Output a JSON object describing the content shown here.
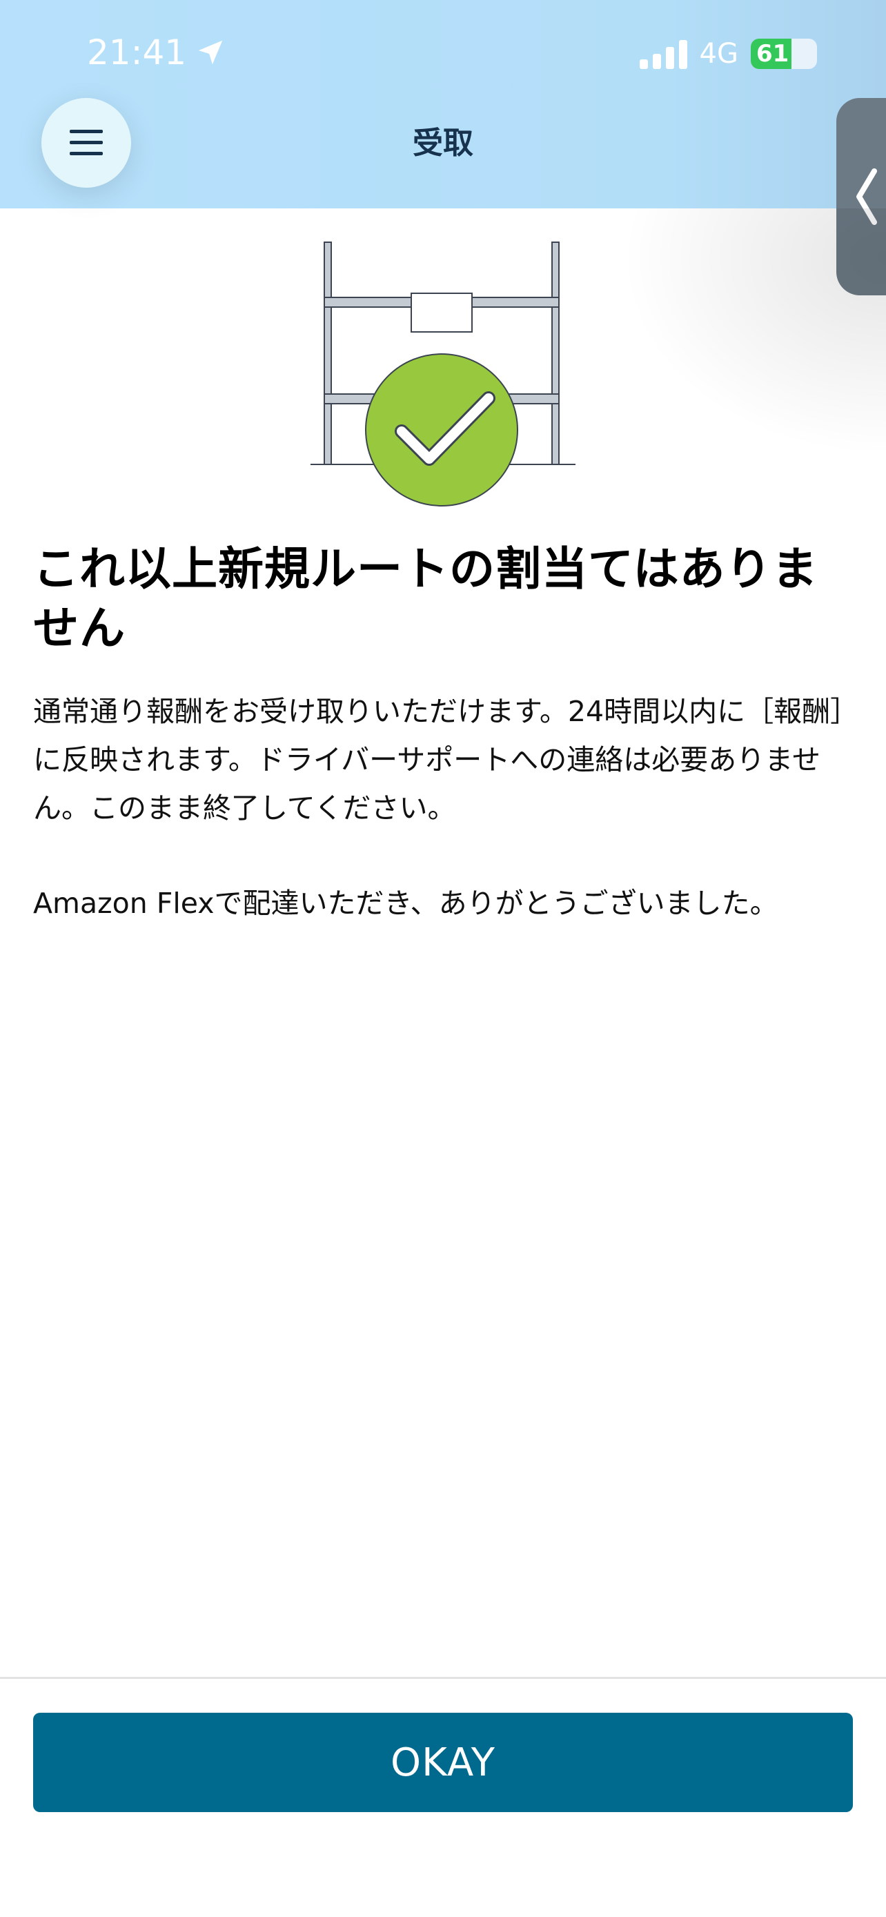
{
  "status_bar": {
    "time": "21:41",
    "network": "4G",
    "battery": "61",
    "battery_level": 0.61,
    "location_icon": "location-arrow-icon",
    "signal_icon": "signal-bars-icon"
  },
  "header": {
    "title": "受取",
    "menu_icon": "hamburger-menu-icon",
    "side_tab_icon": "chevron-left-icon"
  },
  "illustration": {
    "icon": "shelf-checkmark-icon",
    "check_color": "#97c83e"
  },
  "content": {
    "headline": "これ以上新規ルートの割当てはありません",
    "body": "通常通り報酬をお受け取りいただけます。24時間以内に［報酬］に反映されます。ドライバーサポートへの連絡は必要ありません。このまま終了してください。",
    "thanks": "Amazon Flexで配達いただき、ありがとうございました。"
  },
  "footer": {
    "ok_label": "OKAY"
  },
  "colors": {
    "header_bg": "#b6e0fb",
    "primary_button": "#006a8e",
    "title_text": "#17324d"
  }
}
